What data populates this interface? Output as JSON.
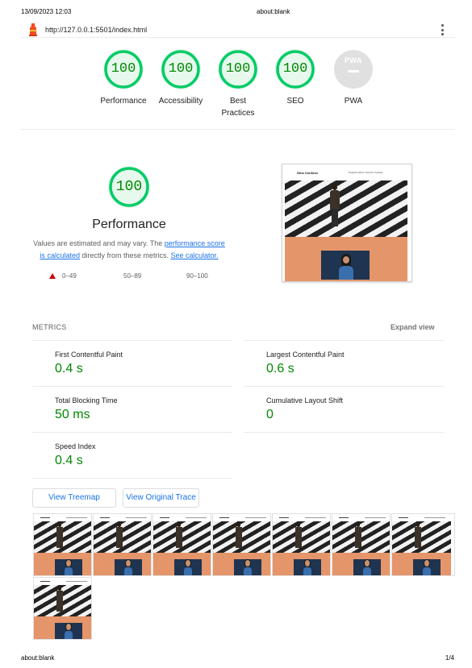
{
  "print": {
    "date": "13/09/2023 12:03",
    "title": "about:blank",
    "footer_url": "about:blank",
    "page": "1/4"
  },
  "topbar": {
    "url": "http://127.0.0.1:5501/index.html",
    "logo_icon": "lighthouse-icon",
    "menu_icon": "kebab-menu-icon"
  },
  "colors": {
    "pass": "#0c6",
    "pass_text": "#008800",
    "pass_bg": "#e7f8ed",
    "link": "#1a73e8",
    "fail": "#cc0000",
    "screenshot_orange": "#e5956a"
  },
  "scores": [
    {
      "label": "Performance",
      "value": "100",
      "score": 100
    },
    {
      "label": "Accessibility",
      "value": "100",
      "score": 100
    },
    {
      "label": "Best Practices",
      "value": "100",
      "score": 100
    },
    {
      "label": "SEO",
      "value": "100",
      "score": 100
    }
  ],
  "pwa": {
    "badge": "PWA",
    "label": "PWA"
  },
  "performance": {
    "score": "100",
    "title": "Performance",
    "desc_1": "Values are estimated and may vary. The ",
    "desc_link_1": "performance score is calculated",
    "desc_2": " directly from these metrics. ",
    "desc_link_2": "See calculator.",
    "legend": [
      "0–49",
      "50–89",
      "90–100"
    ]
  },
  "final_screenshot": {
    "brand": "Nina Cardoso",
    "links": "Projects  Sobre  Técnico  Contato"
  },
  "metrics": {
    "heading": "METRICS",
    "expand": "Expand view",
    "items": [
      {
        "label": "First Contentful Paint",
        "value": "0.4 s"
      },
      {
        "label": "Largest Contentful Paint",
        "value": "0.6 s"
      },
      {
        "label": "Total Blocking Time",
        "value": "50 ms"
      },
      {
        "label": "Cumulative Layout Shift",
        "value": "0"
      },
      {
        "label": "Speed Index",
        "value": "0.4 s"
      }
    ]
  },
  "buttons": {
    "treemap": "View Treemap",
    "trace": "View Original Trace"
  },
  "filmstrip_frames": 8
}
